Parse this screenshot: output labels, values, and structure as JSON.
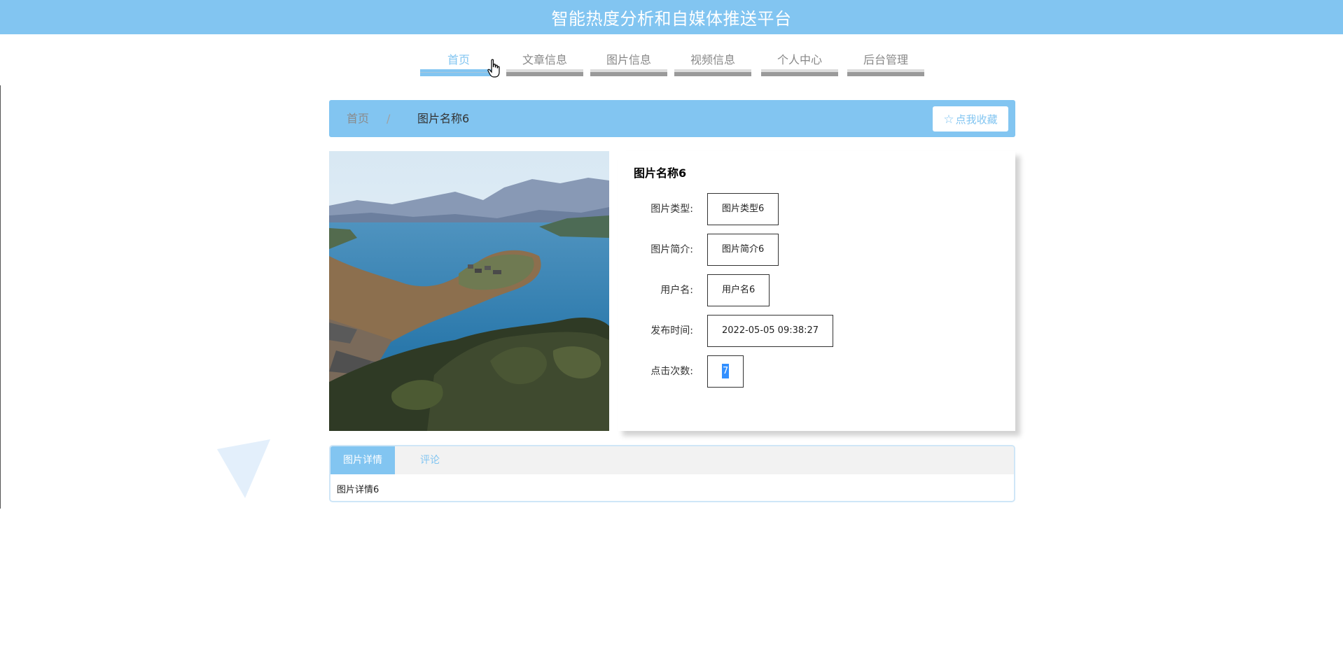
{
  "header": {
    "title": "智能热度分析和自媒体推送平台",
    "background_color": "#82c5f1"
  },
  "nav": {
    "active_index": 0,
    "items": [
      {
        "label": "首页"
      },
      {
        "label": "文章信息"
      },
      {
        "label": "图片信息"
      },
      {
        "label": "视频信息"
      },
      {
        "label": "个人中心"
      },
      {
        "label": "后台管理"
      }
    ]
  },
  "breadcrumb": {
    "home": "首页",
    "separator": "/",
    "current": "图片名称6"
  },
  "favorite_button": {
    "icon": "star-outline-icon",
    "label": "点我收藏"
  },
  "detail": {
    "title": "图片名称6",
    "fields": [
      {
        "label": "图片类型:",
        "value": "图片类型6"
      },
      {
        "label": "图片简介:",
        "value": "图片简介6"
      },
      {
        "label": "用户名:",
        "value": "用户名6"
      },
      {
        "label": "发布时间:",
        "value": "2022-05-05 09:38:27"
      },
      {
        "label": "点击次数:",
        "value": "7"
      }
    ]
  },
  "tabs": {
    "items": [
      {
        "label": "图片详情",
        "active": true
      },
      {
        "label": "评论",
        "active": false
      }
    ],
    "content": "图片详情6"
  },
  "colors": {
    "accent": "#82c5f1",
    "nav_inactive_text": "#888888",
    "selection": "#3390ff"
  }
}
